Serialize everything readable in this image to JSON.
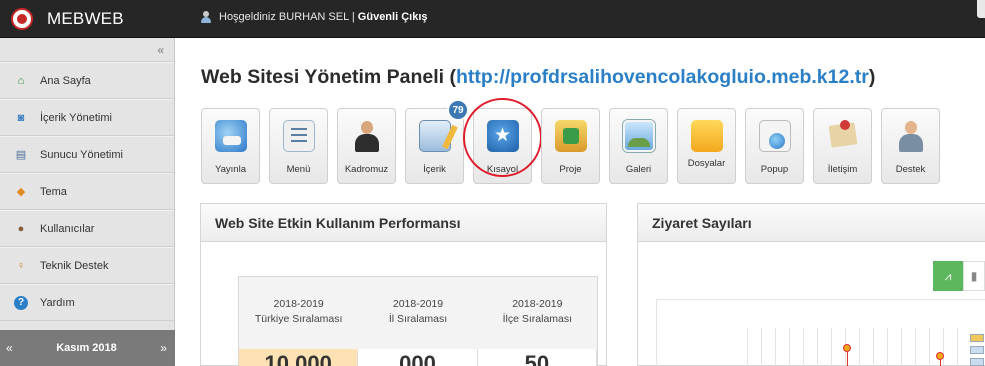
{
  "topbar": {
    "brand": "MEBWEB",
    "welcome_text": "Hoşgeldiniz BURHAN SEL |",
    "logout": "Güvenli Çıkış"
  },
  "sidebar": {
    "collapse": "«",
    "items": [
      {
        "label": "Ana Sayfa",
        "icon": "home-icon"
      },
      {
        "label": "İçerik Yönetimi",
        "icon": "content-icon"
      },
      {
        "label": "Sunucu Yönetimi",
        "icon": "server-icon"
      },
      {
        "label": "Tema",
        "icon": "theme-icon"
      },
      {
        "label": "Kullanıcılar",
        "icon": "users-icon"
      },
      {
        "label": "Teknik Destek",
        "icon": "support-icon"
      },
      {
        "label": "Yardım",
        "icon": "help-icon"
      }
    ],
    "date": {
      "prev": "«",
      "label": "Kasım 2018",
      "next": "»"
    }
  },
  "main": {
    "title": "Web Sitesi Yönetim Paneli (",
    "url": "http://profdrsalihovencolakogluio.meb.k12.tr",
    "title_end": ")",
    "tiles": [
      {
        "label": "Yayınla",
        "icon": "publish-icon"
      },
      {
        "label": "Menü",
        "icon": "menu-icon"
      },
      {
        "label": "Kadromuz",
        "icon": "staff-icon"
      },
      {
        "label": "İçerik",
        "icon": "content-edit-icon",
        "badge": "79"
      },
      {
        "label": "Kısayol",
        "icon": "star-shortcut-icon"
      },
      {
        "label": "Proje",
        "icon": "project-icon"
      },
      {
        "label": "Galeri",
        "icon": "gallery-icon"
      },
      {
        "label": "Dosyalar",
        "icon": "folder-icon"
      },
      {
        "label": "Popup",
        "icon": "popup-icon"
      },
      {
        "label": "İletişim",
        "icon": "contact-icon"
      },
      {
        "label": "Destek",
        "icon": "support-person-icon"
      }
    ]
  },
  "performance": {
    "heading": "Web Site Etkin Kullanım Performansı",
    "columns": [
      {
        "year": "2018-2019",
        "label": "Türkiye Sıralaması"
      },
      {
        "year": "2018-2019",
        "label": "İl Sıralaması"
      },
      {
        "year": "2018-2019",
        "label": "İlçe Sıralaması"
      }
    ],
    "values": [
      "10.000",
      "000",
      "50"
    ]
  },
  "visits": {
    "heading": "Ziyaret Sayıları",
    "line_btn_icon": "line-chart-icon",
    "bar_btn_icon": "bar-chart-icon",
    "accent": "#5cb85c"
  }
}
